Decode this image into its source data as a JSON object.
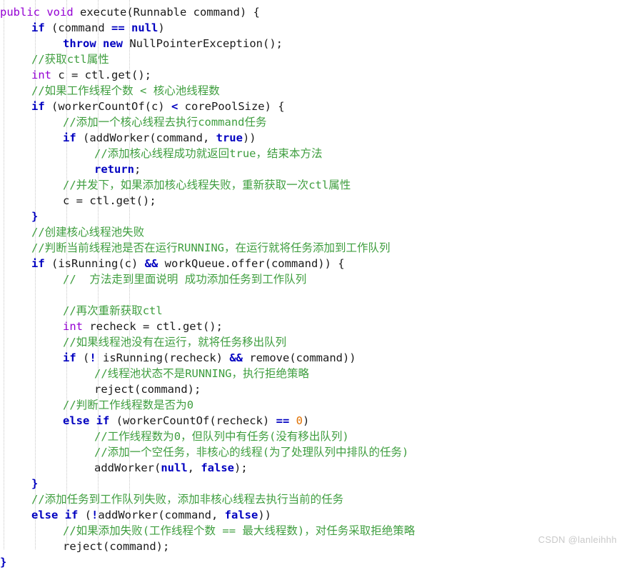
{
  "viewer": {
    "kind": "code-screenshot",
    "language": "Java",
    "background_color": "#ffffff",
    "indent_guides": [
      5,
      49,
      93,
      137,
      181
    ],
    "watermark": "CSDN @lanleihhh"
  },
  "theme": {
    "keyword_color": "#0000c0",
    "type_color": "#9400d3",
    "comment_color": "#3f9e3f",
    "number_color": "#e07000",
    "plain_color": "#1a1a1a",
    "watermark_color": "#c9c9c9",
    "guide_color": "#c8c8c8"
  },
  "code": {
    "lines": [
      {
        "indent": 0,
        "tokens": [
          {
            "t": "type",
            "s": "public"
          },
          {
            "t": "plain",
            "s": " "
          },
          {
            "t": "type",
            "s": "void"
          },
          {
            "t": "plain",
            "s": " execute(Runnable command) {"
          }
        ]
      },
      {
        "indent": 4,
        "tokens": [
          {
            "t": "kw",
            "s": "if"
          },
          {
            "t": "plain",
            "s": " (command "
          },
          {
            "t": "op",
            "s": "=="
          },
          {
            "t": "plain",
            "s": " "
          },
          {
            "t": "kw",
            "s": "null"
          },
          {
            "t": "plain",
            "s": ")"
          }
        ]
      },
      {
        "indent": 8,
        "tokens": [
          {
            "t": "kw",
            "s": "throw"
          },
          {
            "t": "plain",
            "s": " "
          },
          {
            "t": "kw",
            "s": "new"
          },
          {
            "t": "plain",
            "s": " NullPointerException();"
          }
        ]
      },
      {
        "indent": 4,
        "tokens": [
          {
            "t": "comment",
            "s": "//获取ctl属性"
          }
        ]
      },
      {
        "indent": 4,
        "tokens": [
          {
            "t": "type",
            "s": "int"
          },
          {
            "t": "plain",
            "s": " c = ctl.get();"
          }
        ]
      },
      {
        "indent": 4,
        "tokens": [
          {
            "t": "comment",
            "s": "//如果工作线程个数 < 核心池线程数"
          }
        ]
      },
      {
        "indent": 4,
        "tokens": [
          {
            "t": "kw",
            "s": "if"
          },
          {
            "t": "plain",
            "s": " (workerCountOf(c) "
          },
          {
            "t": "op",
            "s": "<"
          },
          {
            "t": "plain",
            "s": " corePoolSize) {"
          }
        ]
      },
      {
        "indent": 8,
        "tokens": [
          {
            "t": "comment",
            "s": "//添加一个核心线程去执行command任务"
          }
        ]
      },
      {
        "indent": 8,
        "tokens": [
          {
            "t": "kw",
            "s": "if"
          },
          {
            "t": "plain",
            "s": " (addWorker(command, "
          },
          {
            "t": "kw",
            "s": "true"
          },
          {
            "t": "plain",
            "s": "))"
          }
        ]
      },
      {
        "indent": 12,
        "tokens": [
          {
            "t": "comment",
            "s": "//添加核心线程成功就返回true，结束本方法"
          }
        ]
      },
      {
        "indent": 12,
        "tokens": [
          {
            "t": "kw",
            "s": "return"
          },
          {
            "t": "plain",
            "s": ";"
          }
        ]
      },
      {
        "indent": 8,
        "tokens": [
          {
            "t": "comment",
            "s": "//并发下，如果添加核心线程失败，重新获取一次ctl属性"
          }
        ]
      },
      {
        "indent": 8,
        "tokens": [
          {
            "t": "plain",
            "s": "c = ctl.get();"
          }
        ]
      },
      {
        "indent": 4,
        "tokens": [
          {
            "t": "kw",
            "s": "}"
          }
        ]
      },
      {
        "indent": 4,
        "tokens": [
          {
            "t": "comment",
            "s": "//创建核心线程池失败"
          }
        ]
      },
      {
        "indent": 4,
        "tokens": [
          {
            "t": "comment",
            "s": "//判断当前线程池是否在运行RUNNING，在运行就将任务添加到工作队列"
          }
        ]
      },
      {
        "indent": 4,
        "tokens": [
          {
            "t": "kw",
            "s": "if"
          },
          {
            "t": "plain",
            "s": " (isRunning(c) "
          },
          {
            "t": "op",
            "s": "&&"
          },
          {
            "t": "plain",
            "s": " workQueue.offer(command)) {"
          }
        ]
      },
      {
        "indent": 8,
        "tokens": [
          {
            "t": "comment",
            "s": "//  方法走到里面说明 成功添加任务到工作队列"
          }
        ]
      },
      {
        "indent": 0,
        "tokens": []
      },
      {
        "indent": 8,
        "tokens": [
          {
            "t": "comment",
            "s": "//再次重新获取ctl"
          }
        ]
      },
      {
        "indent": 8,
        "tokens": [
          {
            "t": "type",
            "s": "int"
          },
          {
            "t": "plain",
            "s": " recheck = ctl.get();"
          }
        ]
      },
      {
        "indent": 8,
        "tokens": [
          {
            "t": "comment",
            "s": "//如果线程池没有在运行，就将任务移出队列"
          }
        ]
      },
      {
        "indent": 8,
        "tokens": [
          {
            "t": "kw",
            "s": "if"
          },
          {
            "t": "plain",
            "s": " ("
          },
          {
            "t": "op",
            "s": "!"
          },
          {
            "t": "plain",
            "s": " isRunning(recheck) "
          },
          {
            "t": "op",
            "s": "&&"
          },
          {
            "t": "plain",
            "s": " remove(command))"
          }
        ]
      },
      {
        "indent": 12,
        "tokens": [
          {
            "t": "comment",
            "s": "//线程池状态不是RUNNING，执行拒绝策略"
          }
        ]
      },
      {
        "indent": 12,
        "tokens": [
          {
            "t": "plain",
            "s": "reject(command);"
          }
        ]
      },
      {
        "indent": 8,
        "tokens": [
          {
            "t": "comment",
            "s": "//判断工作线程数是否为0"
          }
        ]
      },
      {
        "indent": 8,
        "tokens": [
          {
            "t": "kw",
            "s": "else"
          },
          {
            "t": "plain",
            "s": " "
          },
          {
            "t": "kw",
            "s": "if"
          },
          {
            "t": "plain",
            "s": " (workerCountOf(recheck) "
          },
          {
            "t": "op",
            "s": "=="
          },
          {
            "t": "plain",
            "s": " "
          },
          {
            "t": "num",
            "s": "0"
          },
          {
            "t": "plain",
            "s": ")"
          }
        ]
      },
      {
        "indent": 12,
        "tokens": [
          {
            "t": "comment",
            "s": "//工作线程数为0，但队列中有任务(没有移出队列)"
          }
        ]
      },
      {
        "indent": 12,
        "tokens": [
          {
            "t": "comment",
            "s": "//添加一个空任务，非核心的线程(为了处理队列中排队的任务)"
          }
        ]
      },
      {
        "indent": 12,
        "tokens": [
          {
            "t": "plain",
            "s": "addWorker("
          },
          {
            "t": "kw",
            "s": "null"
          },
          {
            "t": "plain",
            "s": ", "
          },
          {
            "t": "kw",
            "s": "false"
          },
          {
            "t": "plain",
            "s": ");"
          }
        ]
      },
      {
        "indent": 4,
        "tokens": [
          {
            "t": "kw",
            "s": "}"
          }
        ]
      },
      {
        "indent": 4,
        "tokens": [
          {
            "t": "comment",
            "s": "//添加任务到工作队列失败，添加非核心线程去执行当前的任务"
          }
        ]
      },
      {
        "indent": 4,
        "tokens": [
          {
            "t": "kw",
            "s": "else"
          },
          {
            "t": "plain",
            "s": " "
          },
          {
            "t": "kw",
            "s": "if"
          },
          {
            "t": "plain",
            "s": " ("
          },
          {
            "t": "op",
            "s": "!"
          },
          {
            "t": "plain",
            "s": "addWorker(command, "
          },
          {
            "t": "kw",
            "s": "false"
          },
          {
            "t": "plain",
            "s": "))"
          }
        ]
      },
      {
        "indent": 8,
        "tokens": [
          {
            "t": "comment",
            "s": "//如果添加失败(工作线程个数 == 最大线程数)，对任务采取拒绝策略"
          }
        ]
      },
      {
        "indent": 8,
        "tokens": [
          {
            "t": "plain",
            "s": "reject(command);"
          }
        ]
      },
      {
        "indent": 0,
        "tokens": [
          {
            "t": "kw",
            "s": "}"
          }
        ]
      }
    ]
  }
}
